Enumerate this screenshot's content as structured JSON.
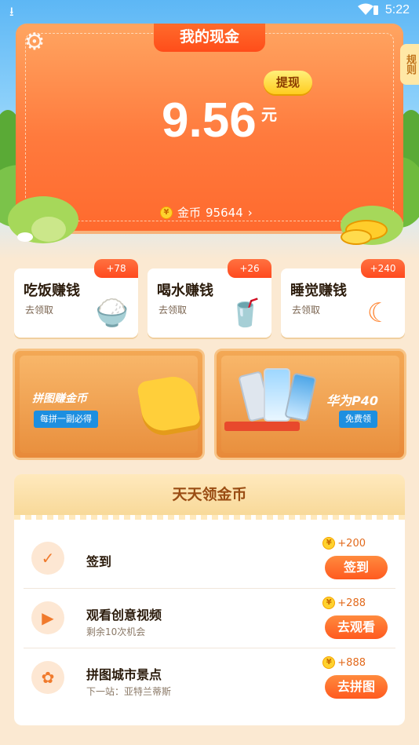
{
  "status_bar": {
    "time": "5:22"
  },
  "cash_card": {
    "title": "我的现金",
    "amount": "9.56",
    "unit": "元",
    "withdraw_label": "提现",
    "coin_label": "金币",
    "coin_value": "95644",
    "coin_arrow": "›",
    "rules_label": "规则",
    "coin_symbol": "¥"
  },
  "tasks": [
    {
      "name": "吃饭赚钱",
      "sub": "去领取",
      "badge": "+78",
      "icon": "rice-bowl-icon",
      "glyph": "🍚"
    },
    {
      "name": "喝水赚钱",
      "sub": "去领取",
      "badge": "+26",
      "icon": "cup-icon",
      "glyph": "🥤"
    },
    {
      "name": "睡觉赚钱",
      "sub": "去领取",
      "badge": "+240",
      "icon": "moon-sleep-icon",
      "glyph": "☾"
    }
  ],
  "banners": {
    "puzzle": {
      "title": "拼图赚金币",
      "button": "每拼一副必得"
    },
    "huawei": {
      "title": "华为P40",
      "button": "免费领"
    }
  },
  "daily": {
    "title": "天天领金币",
    "rows": [
      {
        "name": "签到",
        "sub": "",
        "reward": "+200",
        "button": "签到",
        "icon": "calendar-check-icon",
        "glyph": "✓"
      },
      {
        "name": "观看创意视频",
        "sub": "剩余10次机会",
        "reward": "+288",
        "button": "去观看",
        "icon": "video-play-icon",
        "glyph": "▶"
      },
      {
        "name": "拼图城市景点",
        "sub": "下一站：亚特兰蒂斯",
        "reward": "+888",
        "button": "去拼图",
        "icon": "puzzle-piece-icon",
        "glyph": "✿"
      }
    ]
  },
  "colors": {
    "card_orange": "#ff7a3d",
    "accent_red": "#ff5a1f",
    "gold": "#ffd22e",
    "daily_header": "#f8d999"
  }
}
